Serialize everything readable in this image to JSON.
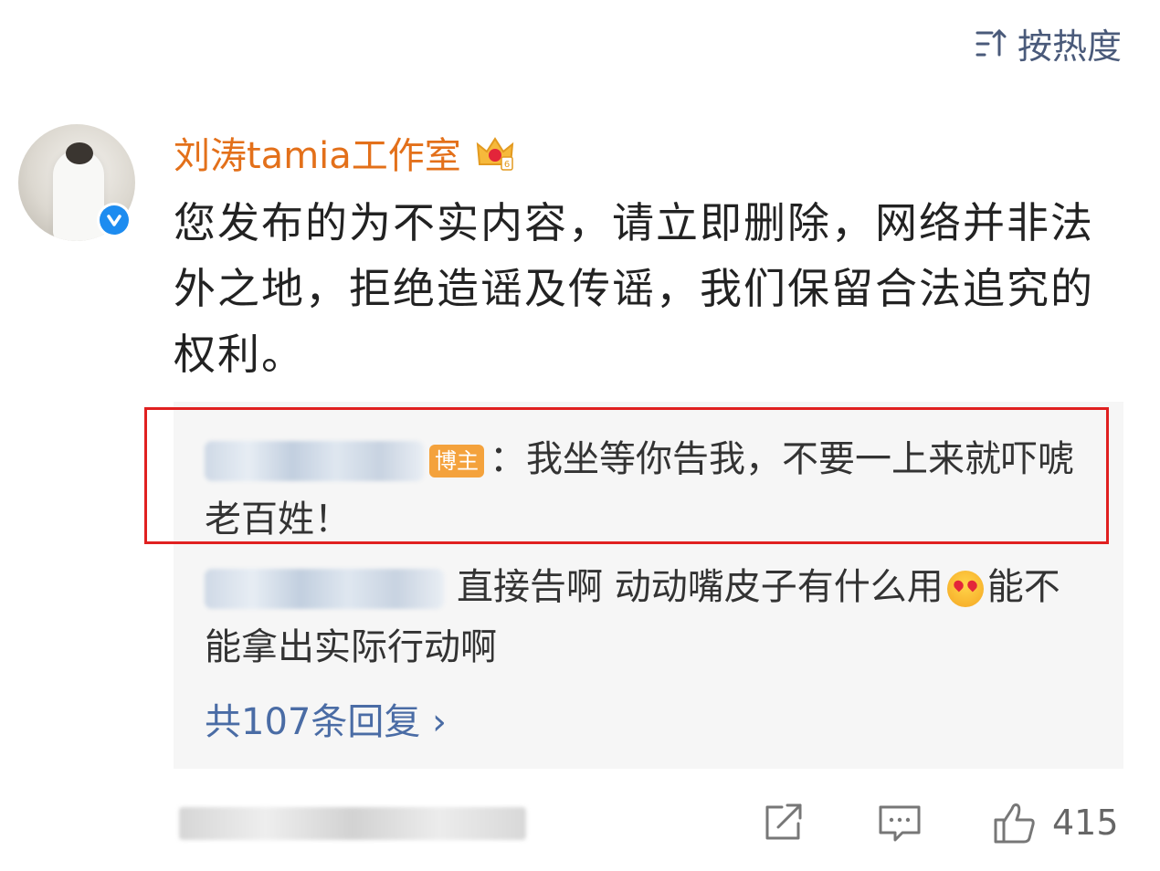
{
  "sort": {
    "label": "按热度",
    "icon": "sort-icon"
  },
  "post": {
    "author": "刘涛tamia工作室",
    "text": "您发布的为不实内容，请立即删除，网络并非法外之地，拒绝造谣及传谣，我们保留合法追究的权利。",
    "badges": [
      "verified-icon",
      "crown-badge-icon"
    ]
  },
  "replies": [
    {
      "tag": "博主",
      "text": "：我坐等你告我，不要一上来就吓唬老百姓！",
      "highlighted": true
    },
    {
      "text_before_emoji": "直接告啊 动动嘴皮子有什么用",
      "text_after_emoji": "能不能拿出实际行动啊",
      "emoji": "heart-eyes-emoji"
    }
  ],
  "more_replies": "共107条回复 ›",
  "actions": {
    "share_icon": "share-icon",
    "comment_icon": "comment-icon",
    "like_icon": "like-icon",
    "like_count": "415"
  },
  "colors": {
    "author": "#e3701a",
    "link": "#4a6ca5",
    "highlight_border": "#e02020",
    "panel_bg": "#f6f6f6"
  }
}
